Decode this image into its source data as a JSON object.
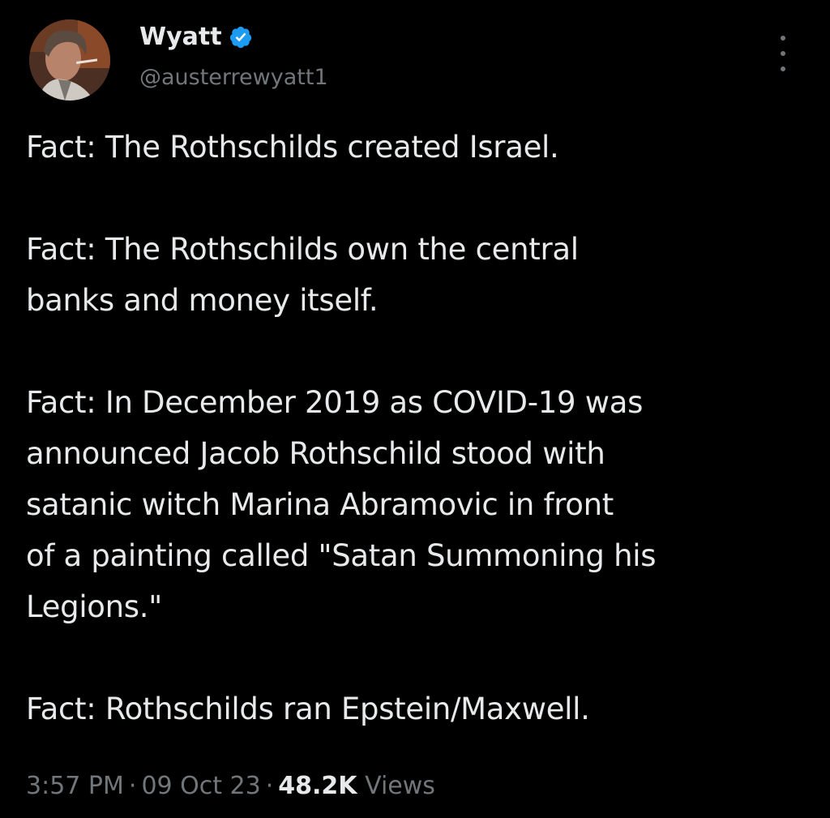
{
  "author": {
    "display_name": "Wyatt",
    "handle": "@austerrewyatt1",
    "verified_icon": "verified-badge-icon",
    "verified_color": "#1d9bf0"
  },
  "tweet": {
    "paragraphs": [
      "Fact: The Rothschilds created Israel.",
      "Fact: The Rothschilds own the central\nbanks and money itself.",
      "Fact: In December 2019 as COVID-19 was\nannounced Jacob Rothschild stood with\nsatanic witch Marina Abramovic in front\nof a painting called \"Satan Summoning his\nLegions.\"",
      "Fact: Rothschilds ran Epstein/Maxwell."
    ]
  },
  "meta": {
    "time": "3:57 PM",
    "separator": "·",
    "date": "09 Oct 23",
    "views_count": "48.2K",
    "views_label": "Views"
  },
  "icons": {
    "more": "more-options-icon",
    "avatar": "avatar-image"
  },
  "colors": {
    "background": "#000000",
    "text": "#e7e9ea",
    "secondary": "#71767b"
  }
}
